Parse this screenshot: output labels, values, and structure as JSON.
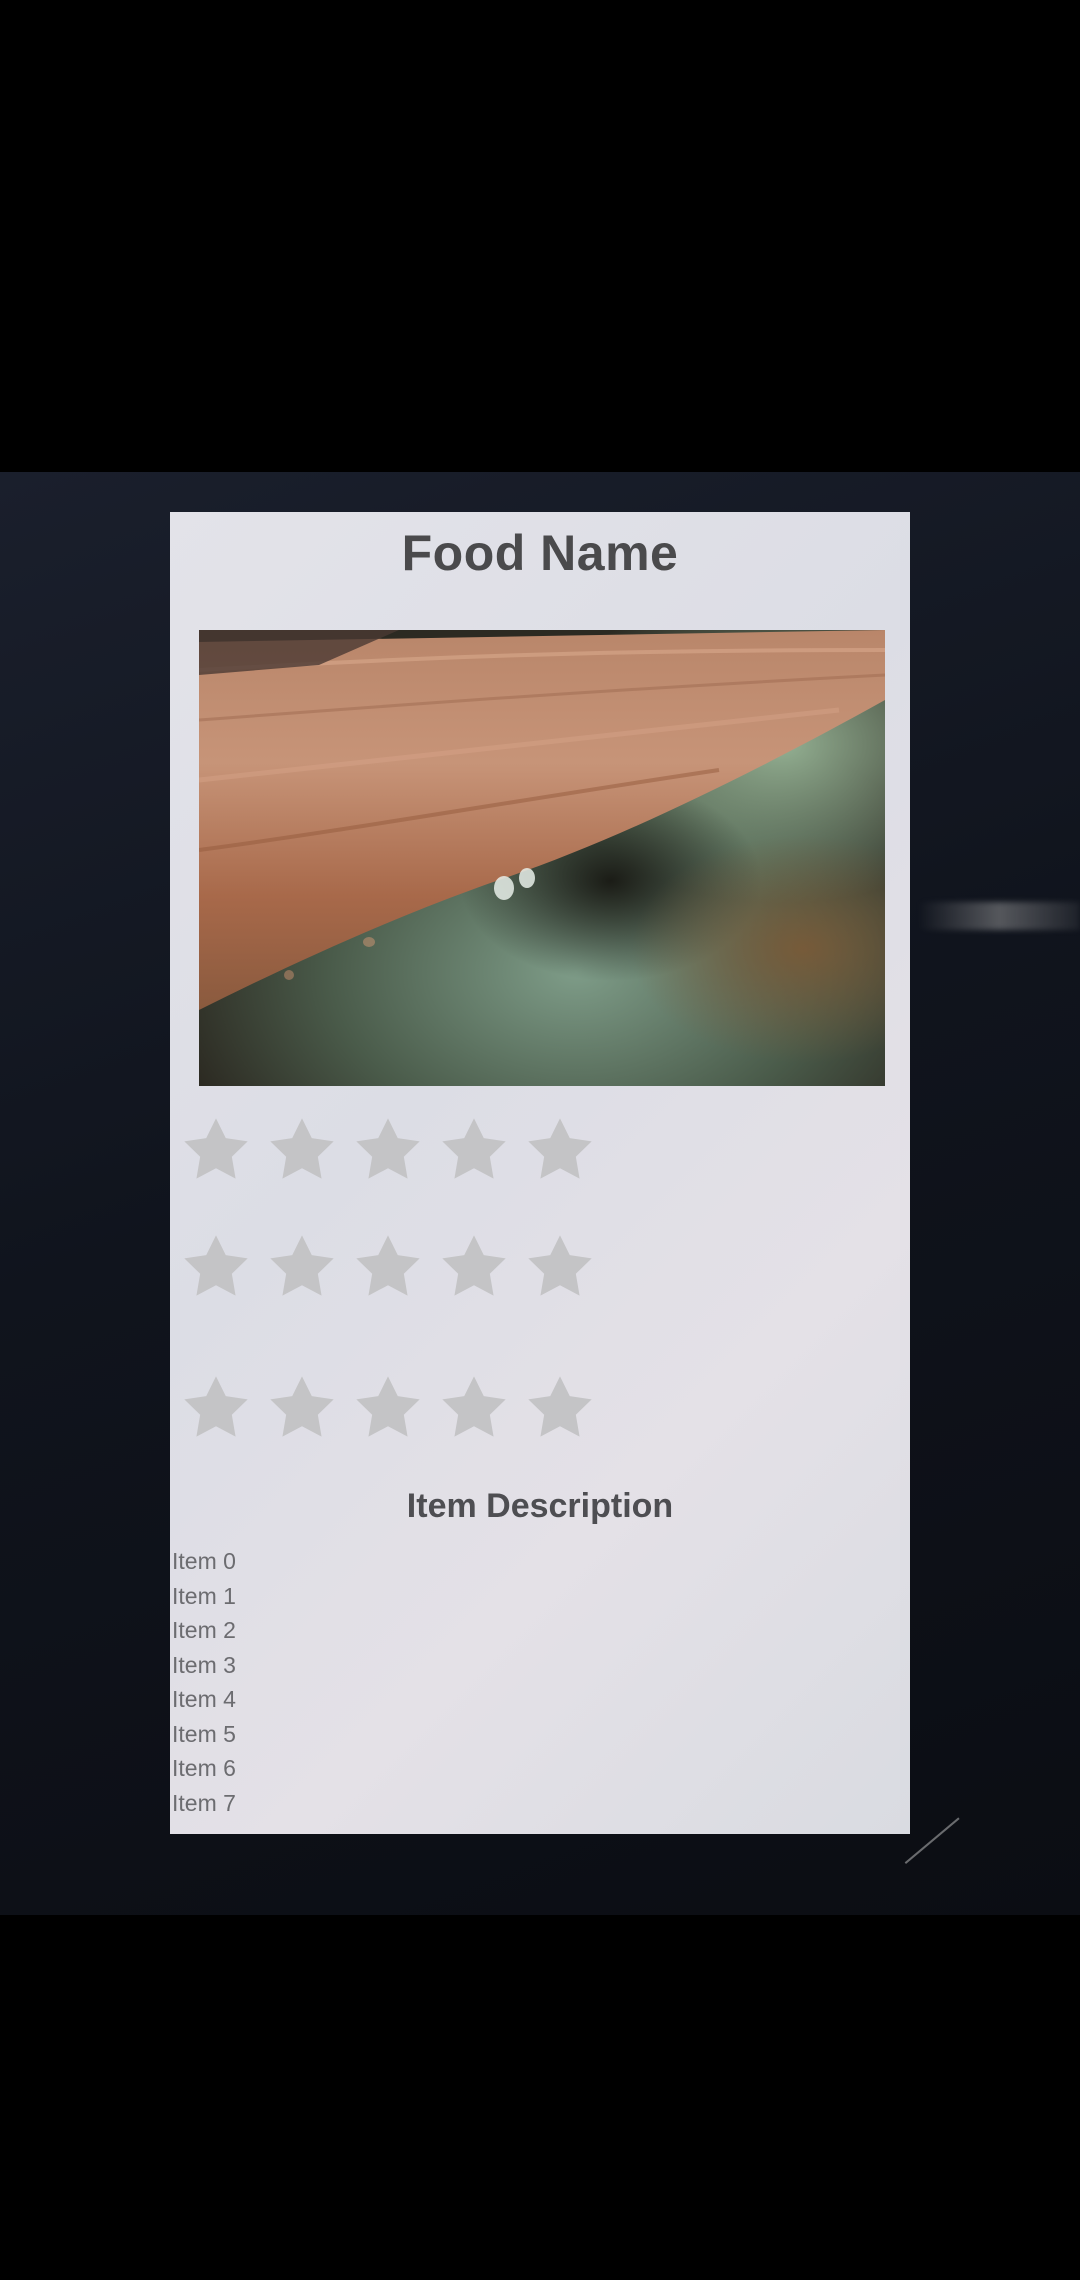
{
  "app": {
    "title": "Food Name",
    "image_icon": "food-photo",
    "rating_icon": "star-icon",
    "rating_rows": [
      {
        "stars": 5
      },
      {
        "stars": 5
      },
      {
        "stars": 5
      }
    ],
    "description_title": "Item Description",
    "items": [
      "Item 0",
      "Item 1",
      "Item 2",
      "Item 3",
      "Item 4",
      "Item 5",
      "Item 6",
      "Item 7"
    ]
  },
  "colors": {
    "screen_background": "#dfe0e6",
    "title_text": "#4a4a4c",
    "star_fill": "#c4c4c6",
    "item_text": "#6c6c70"
  }
}
